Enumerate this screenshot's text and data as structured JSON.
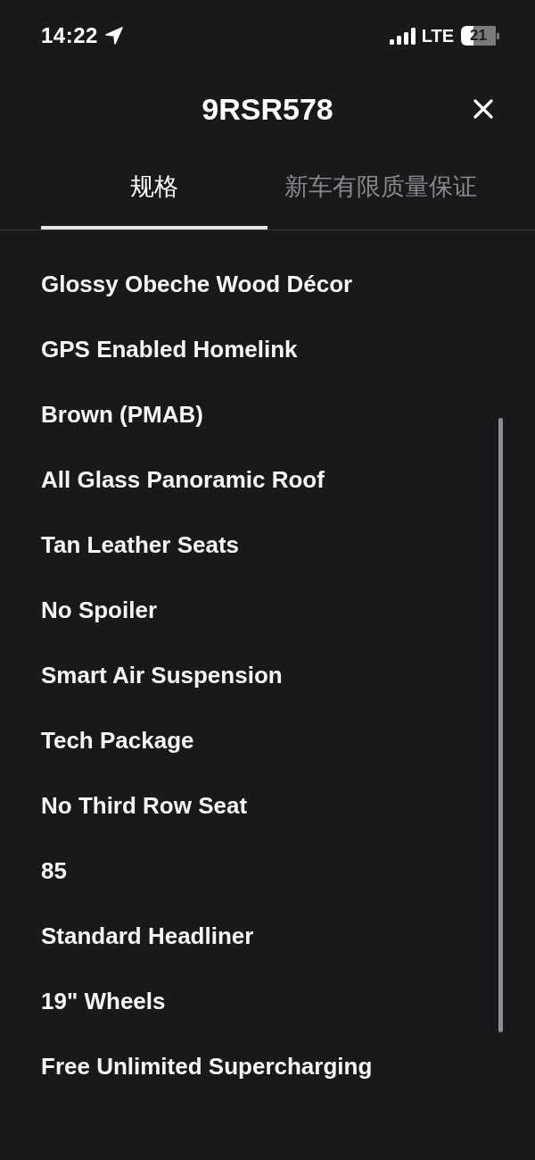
{
  "status_bar": {
    "time": "14:22",
    "network": "LTE",
    "battery": "21"
  },
  "header": {
    "title": "9RSR578"
  },
  "tabs": [
    {
      "label": "规格",
      "selected": true
    },
    {
      "label": "新车有限质量保证",
      "selected": false
    }
  ],
  "spec_items": [
    "Glossy Obeche Wood Décor",
    "GPS Enabled Homelink",
    "Brown (PMAB)",
    "All Glass Panoramic Roof",
    "Tan Leather Seats",
    "No Spoiler",
    "Smart Air Suspension",
    "Tech Package",
    "No Third Row Seat",
    "85",
    "Standard Headliner",
    "19\" Wheels",
    "Free Unlimited Supercharging"
  ]
}
